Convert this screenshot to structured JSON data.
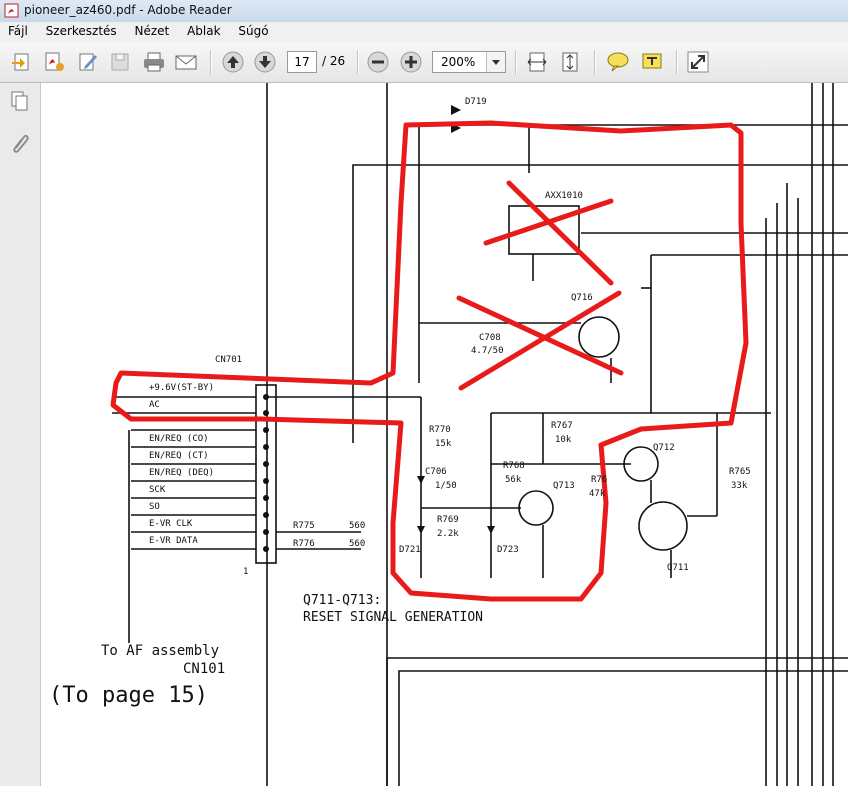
{
  "window": {
    "title": "pioneer_az460.pdf - Adobe Reader"
  },
  "menu": {
    "items": [
      "Fájl",
      "Szerkesztés",
      "Nézet",
      "Ablak",
      "Súgó"
    ]
  },
  "toolbar": {
    "current_page": "17",
    "total_pages": "/ 26",
    "zoom": "200%"
  },
  "schematic": {
    "connector_name": "CN701",
    "pin_labels": [
      "+9.6V(ST-BY)",
      "AC",
      "",
      "EN/REQ (CO)",
      "EN/REQ (CT)",
      "EN/REQ (DEQ)",
      "SCK",
      "SO",
      "E-VR CLK",
      "E-VR DATA"
    ],
    "pin1": "1",
    "d719": "D719",
    "axx": "AXX1010",
    "q716": "Q716",
    "c708": "C708",
    "c708_val": "4.7/50",
    "r770": "R770",
    "r770_val": "15k",
    "c706": "C706",
    "c706_val": "1/50",
    "r769": "R769",
    "r769_val": "2.2k",
    "d721": "D721",
    "d723": "D723",
    "r767": "R767",
    "r767_val": "10k",
    "r768": "R768",
    "r768_val": "56k",
    "q713": "Q713",
    "r766": "R76",
    "r766_val": "47k",
    "q712": "Q712",
    "r765": "R765",
    "r765_val": "33k",
    "q711": "Q711",
    "r775": "R775",
    "r775_val": "560",
    "r776": "R776",
    "r776_val": "560",
    "caption1": "Q711-Q713:",
    "caption2": "RESET SIGNAL GENERATION",
    "to_af": "To AF assembly",
    "to_af_cn": "CN101",
    "to_page": "(To page 15)"
  },
  "colors": {
    "annotation": "#e81a1a",
    "titlebar": "#c9d9ec"
  }
}
